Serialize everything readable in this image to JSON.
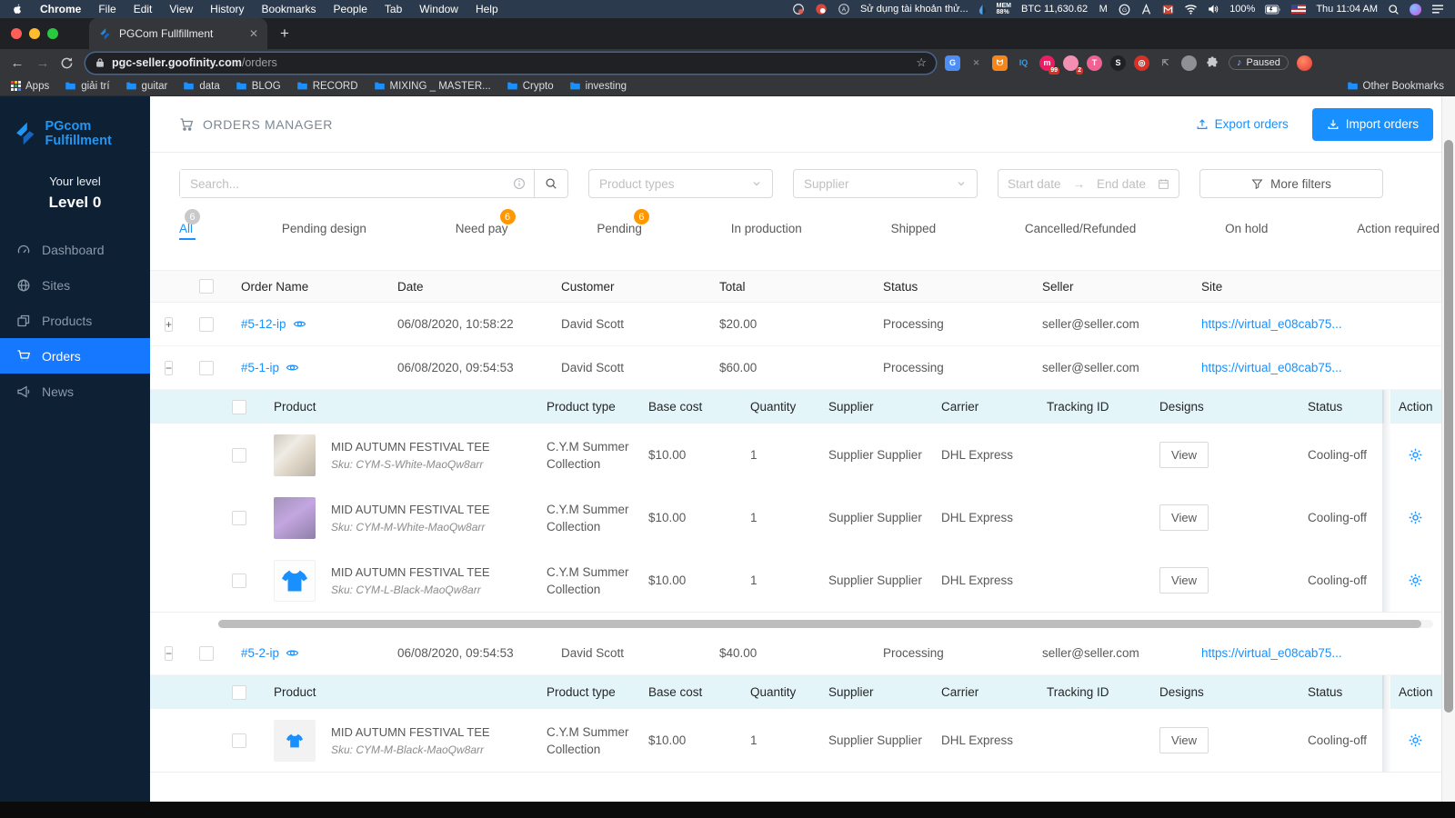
{
  "accent": "#1890ff",
  "menubar": {
    "menus": [
      "Chrome",
      "File",
      "Edit",
      "View",
      "History",
      "Bookmarks",
      "People",
      "Tab",
      "Window",
      "Help"
    ],
    "status_text": "Sử dụng tài khoản thử...",
    "mem_label": "MEM",
    "mem_value": "88%",
    "btc": "BTC 11,630.62",
    "battery": "100%",
    "clock": "Thu 11:04 AM"
  },
  "browser": {
    "tab_title": "PGCom Fullfillment",
    "url_host": "pgc-seller.goofinity.com",
    "url_path": "/orders",
    "paused_label": "Paused",
    "ext_iq": "IQ",
    "ext_badge_99": "99",
    "ext_badge_2": "2",
    "bookmarks": [
      "giải trí",
      "guitar",
      "data",
      "BLOG",
      "RECORD",
      "MIXING _ MASTER...",
      "Crypto",
      "investing"
    ],
    "apps_label": "Apps",
    "other_bookmarks": "Other Bookmarks"
  },
  "sidebar": {
    "brand": "PGcom Fulfillment",
    "level_label": "Your level",
    "level_value": "Level 0",
    "items": [
      {
        "label": "Dashboard",
        "icon": "gauge-icon",
        "active": false
      },
      {
        "label": "Sites",
        "icon": "globe-icon",
        "active": false
      },
      {
        "label": "Products",
        "icon": "products-icon",
        "active": false
      },
      {
        "label": "Orders",
        "icon": "cart-icon",
        "active": true
      },
      {
        "label": "News",
        "icon": "megaphone-icon",
        "active": false
      }
    ]
  },
  "header": {
    "title": "ORDERS MANAGER",
    "export_label": "Export orders",
    "import_label": "Import orders"
  },
  "filters": {
    "search_placeholder": "Search...",
    "product_types": "Product types",
    "supplier": "Supplier",
    "start_date": "Start date",
    "end_date": "End date",
    "more_filters": "More filters"
  },
  "tabs": [
    {
      "label": "All",
      "badge": "6",
      "badge_color": "#c9c9c9",
      "active": true
    },
    {
      "label": "Pending design"
    },
    {
      "label": "Need pay",
      "badge": "6",
      "badge_color": "#ff9800"
    },
    {
      "label": "Pending",
      "badge": "6",
      "badge_color": "#ff9800"
    },
    {
      "label": "In production"
    },
    {
      "label": "Shipped"
    },
    {
      "label": "Cancelled/Refunded"
    },
    {
      "label": "On hold"
    },
    {
      "label": "Action required"
    }
  ],
  "table": {
    "columns": [
      "Order Name",
      "Date",
      "Customer",
      "Total",
      "Status",
      "Seller",
      "Site"
    ],
    "sub_columns": [
      "Product",
      "Product type",
      "Base cost",
      "Quantity",
      "Supplier",
      "Carrier",
      "Tracking ID",
      "Designs",
      "Status",
      "Action"
    ],
    "view_label": "View",
    "orders": [
      {
        "expander": "+",
        "expanded": false,
        "name": "#5-12-ip",
        "date": "06/08/2020, 10:58:22",
        "customer": "David Scott",
        "total": "$20.00",
        "status": "Processing",
        "seller": "seller@seller.com",
        "site": "https://virtual_e08cab75...",
        "items": []
      },
      {
        "expander": "−",
        "expanded": true,
        "name": "#5-1-ip",
        "date": "06/08/2020, 09:54:53",
        "customer": "David Scott",
        "total": "$60.00",
        "status": "Processing",
        "seller": "seller@seller.com",
        "site": "https://virtual_e08cab75...",
        "show_hscroll": true,
        "items": [
          {
            "thumb": "photo-white",
            "product": "MID AUTUMN FESTIVAL TEE",
            "sku": "Sku: CYM-S-White-MaoQw8arr",
            "type": "C.Y.M Summer Collection",
            "base_cost": "$10.00",
            "qty": "1",
            "supplier": "Supplier Supplier",
            "carrier": "DHL Express",
            "tracking": "",
            "status": "Cooling-off"
          },
          {
            "thumb": "photo-purple",
            "product": "MID AUTUMN FESTIVAL TEE",
            "sku": "Sku: CYM-M-White-MaoQw8arr",
            "type": "C.Y.M Summer Collection",
            "base_cost": "$10.00",
            "qty": "1",
            "supplier": "Supplier Supplier",
            "carrier": "DHL Express",
            "tracking": "",
            "status": "Cooling-off"
          },
          {
            "thumb": "tee-black",
            "product": "MID AUTUMN FESTIVAL TEE",
            "sku": "Sku: CYM-L-Black-MaoQw8arr",
            "type": "C.Y.M Summer Collection",
            "base_cost": "$10.00",
            "qty": "1",
            "supplier": "Supplier Supplier",
            "carrier": "DHL Express",
            "tracking": "",
            "status": "Cooling-off"
          }
        ]
      },
      {
        "expander": "−",
        "expanded": true,
        "name": "#5-2-ip",
        "date": "06/08/2020, 09:54:53",
        "customer": "David Scott",
        "total": "$40.00",
        "status": "Processing",
        "seller": "seller@seller.com",
        "site": "https://virtual_e08cab75...",
        "show_hscroll": false,
        "items": [
          {
            "thumb": "tee-gray",
            "product": "MID AUTUMN FESTIVAL TEE",
            "sku": "Sku: CYM-M-Black-MaoQw8arr",
            "type": "C.Y.M Summer Collection",
            "base_cost": "$10.00",
            "qty": "1",
            "supplier": "Supplier Supplier",
            "carrier": "DHL Express",
            "tracking": "",
            "status": "Cooling-off"
          }
        ]
      }
    ]
  }
}
